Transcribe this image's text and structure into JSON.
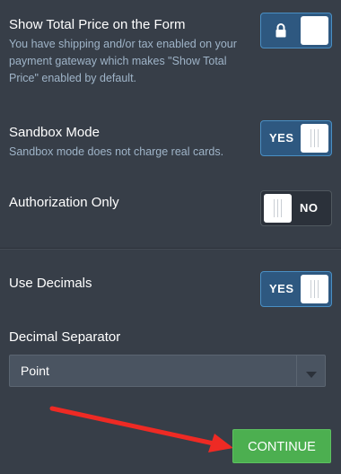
{
  "settings": {
    "show_total_price": {
      "title": "Show Total Price on the Form",
      "description": "You have shipping and/or tax enabled on your payment gateway which makes \"Show Total Price\" enabled by default.",
      "toggle_icon": "lock-icon",
      "toggle_state": "on-locked"
    },
    "sandbox_mode": {
      "title": "Sandbox Mode",
      "description": "Sandbox mode does not charge real cards.",
      "toggle_label": "YES"
    },
    "authorization_only": {
      "title": "Authorization Only",
      "toggle_label": "NO"
    },
    "use_decimals": {
      "title": "Use Decimals",
      "toggle_label": "YES"
    },
    "decimal_separator": {
      "title": "Decimal Separator",
      "selected": "Point"
    }
  },
  "footer": {
    "continue_label": "CONTINUE"
  },
  "colors": {
    "background": "#373e48",
    "description_text": "#9fb4c8",
    "toggle_on": "#2e5880",
    "toggle_on_border": "#4a8fc4",
    "continue_button": "#4caf50",
    "annotation_arrow": "#ee2a24"
  }
}
